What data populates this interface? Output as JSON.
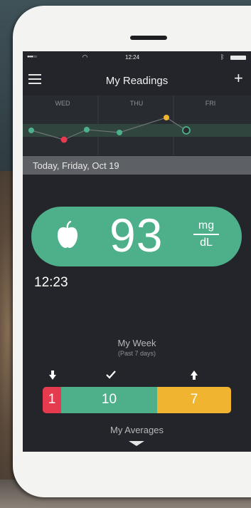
{
  "status_bar": {
    "signal": "●●●○○",
    "wifi": "wifi-icon",
    "time": "12:24",
    "bluetooth": "bluetooth-icon",
    "battery": "battery-icon"
  },
  "nav": {
    "title": "My Readings",
    "menu_icon": "hamburger-menu-icon",
    "add_icon": "plus-icon"
  },
  "trend": {
    "days": [
      "WED",
      "THU",
      "FRI"
    ],
    "points": [
      {
        "status": "in-range"
      },
      {
        "status": "low"
      },
      {
        "status": "in-range"
      },
      {
        "status": "in-range"
      },
      {
        "status": "high"
      },
      {
        "status": "current"
      }
    ]
  },
  "date_banner": "Today, Friday, Oct 19",
  "reading": {
    "value": "93",
    "unit_top": "mg",
    "unit_bottom": "dL",
    "tag_icon": "apple-icon",
    "time": "12:23"
  },
  "week": {
    "title": "My Week",
    "subtitle": "(Past 7 days)",
    "low_icon": "arrow-down-icon",
    "in_range_icon": "checkmark-icon",
    "high_icon": "arrow-up-icon",
    "low_count": "1",
    "in_range_count": "10",
    "high_count": "7"
  },
  "averages": {
    "label": "My Averages",
    "expand_icon": "chevron-down-icon"
  },
  "colors": {
    "green": "#4db08a",
    "red": "#e63a4f",
    "yellow": "#f0b431",
    "screen_bg": "#23252a",
    "banner_bg": "#5d6064"
  }
}
